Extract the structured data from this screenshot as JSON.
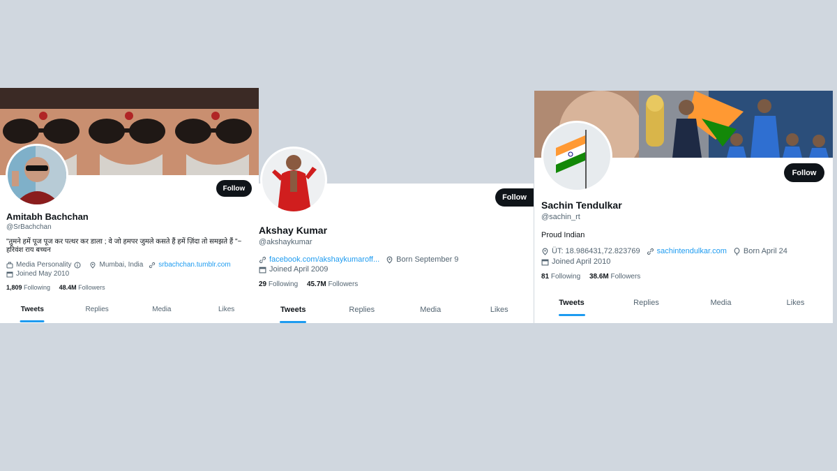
{
  "profiles": [
    {
      "name": "Amitabh Bachchan",
      "handle": "@SrBachchan",
      "follow_label": "Follow",
      "bio": "\"तुमने हमें पूज पूज कर पत्थर कर डाला ; वे जो हमपर जुमले कसते हैं हमें ज़िंदा तो समझते हैं \"~ हरिवंश राय बच्चन",
      "meta": [
        {
          "icon": "briefcase-icon",
          "text": "Media Personality"
        },
        {
          "icon": "location-icon",
          "text": "Mumbai, India"
        },
        {
          "icon": "link-icon",
          "text": "srbachchan.tumblr.com"
        }
      ],
      "joined": "Joined May 2010",
      "following": "1,809",
      "following_label": "Following",
      "followers": "48.4M",
      "followers_label": "Followers",
      "tabs": [
        "Tweets",
        "Replies",
        "Media",
        "Likes"
      ]
    },
    {
      "name": "Akshay Kumar",
      "handle": "@akshaykumar",
      "follow_label": "Follow",
      "meta": [
        {
          "icon": "link-icon",
          "text": "facebook.com/akshaykumaroff..."
        },
        {
          "icon": "location-icon",
          "text": "Born September 9"
        }
      ],
      "joined": "Joined April 2009",
      "following": "29",
      "following_label": "Following",
      "followers": "45.7M",
      "followers_label": "Followers",
      "tabs": [
        "Tweets",
        "Replies",
        "Media",
        "Likes"
      ]
    },
    {
      "name": "Sachin Tendulkar",
      "handle": "@sachin_rt",
      "follow_label": "Follow",
      "bio": "Proud Indian",
      "meta": [
        {
          "icon": "location-icon",
          "text": "ÜT: 18.986431,72.823769"
        },
        {
          "icon": "link-icon",
          "text": "sachintendulkar.com"
        },
        {
          "icon": "balloon-icon",
          "text": "Born April 24"
        }
      ],
      "joined": "Joined April 2010",
      "following": "81",
      "following_label": "Following",
      "followers": "38.6M",
      "followers_label": "Followers",
      "tabs": [
        "Tweets",
        "Replies",
        "Media",
        "Likes"
      ]
    }
  ],
  "colors": {
    "accent": "#1d9bf0",
    "button": "#0f1419",
    "muted": "#536471",
    "background": "#d0d7df"
  }
}
